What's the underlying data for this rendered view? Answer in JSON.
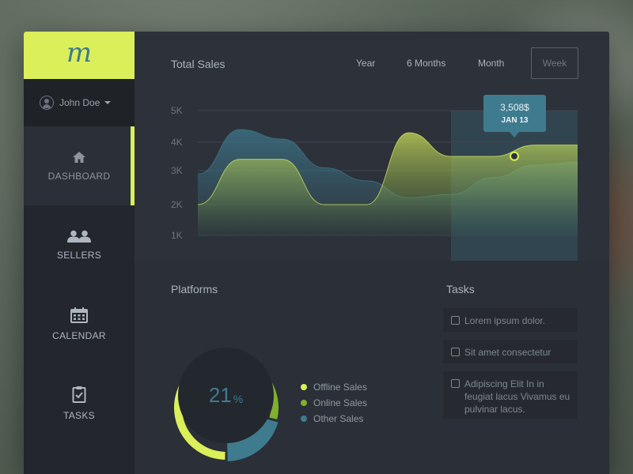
{
  "app": {
    "logo_text": "m"
  },
  "user": {
    "name": "John Doe"
  },
  "sidebar": {
    "items": [
      {
        "label": "DASHBOARD",
        "icon": "home-icon",
        "active": true
      },
      {
        "label": "SELLERS",
        "icon": "users-icon",
        "active": false
      },
      {
        "label": "CALENDAR",
        "icon": "calendar-icon",
        "active": false
      },
      {
        "label": "TASKS",
        "icon": "clipboard-icon",
        "active": false
      }
    ]
  },
  "sales": {
    "title": "Total Sales",
    "ranges": [
      "Year",
      "6 Months",
      "Month",
      "Week"
    ],
    "selected_range": "Week",
    "tooltip": {
      "value": "3,508$",
      "date": "JAN 13"
    }
  },
  "chart_data": {
    "type": "area",
    "y_ticks": [
      "5K",
      "4K",
      "3K",
      "2K",
      "1K"
    ],
    "ylim": [
      1000,
      5000
    ],
    "grid": true,
    "series": [
      {
        "color": "#3e7b8f",
        "values": [
          2900,
          4400,
          4100,
          3100,
          2700,
          2200,
          2300,
          2800,
          3200,
          3300
        ]
      },
      {
        "color": "#dbef5a",
        "values": [
          2000,
          3400,
          3400,
          2000,
          2000,
          4300,
          3500,
          3500,
          3900,
          3900
        ]
      }
    ],
    "highlight": {
      "series": 1,
      "value": 3508,
      "label": "3,508$",
      "date": "JAN 13"
    }
  },
  "platforms": {
    "title": "Platforms",
    "center_value": "21",
    "center_unit": "%",
    "segments": [
      {
        "label": "Offline Sales",
        "color": "#dbef5a",
        "fraction": 0.5
      },
      {
        "label": "Online Sales",
        "color": "#7fb02e",
        "fraction": 0.29
      },
      {
        "label": "Other Sales",
        "color": "#3e7b8f",
        "fraction": 0.21
      }
    ]
  },
  "tasks": {
    "title": "Tasks",
    "items": [
      {
        "text": "Lorem ipsum dolor.",
        "checked": false
      },
      {
        "text": "Sit amet consectetur",
        "checked": false
      },
      {
        "text": "Adipiscing Elit In in feugiat lacus Vivamus eu pulvinar lacus.",
        "checked": false
      }
    ]
  },
  "colors": {
    "accent": "#dbef5a",
    "blue": "#3e7b8f",
    "green": "#7fb02e",
    "panel": "#2b2f37",
    "sidebar": "#23262c"
  }
}
